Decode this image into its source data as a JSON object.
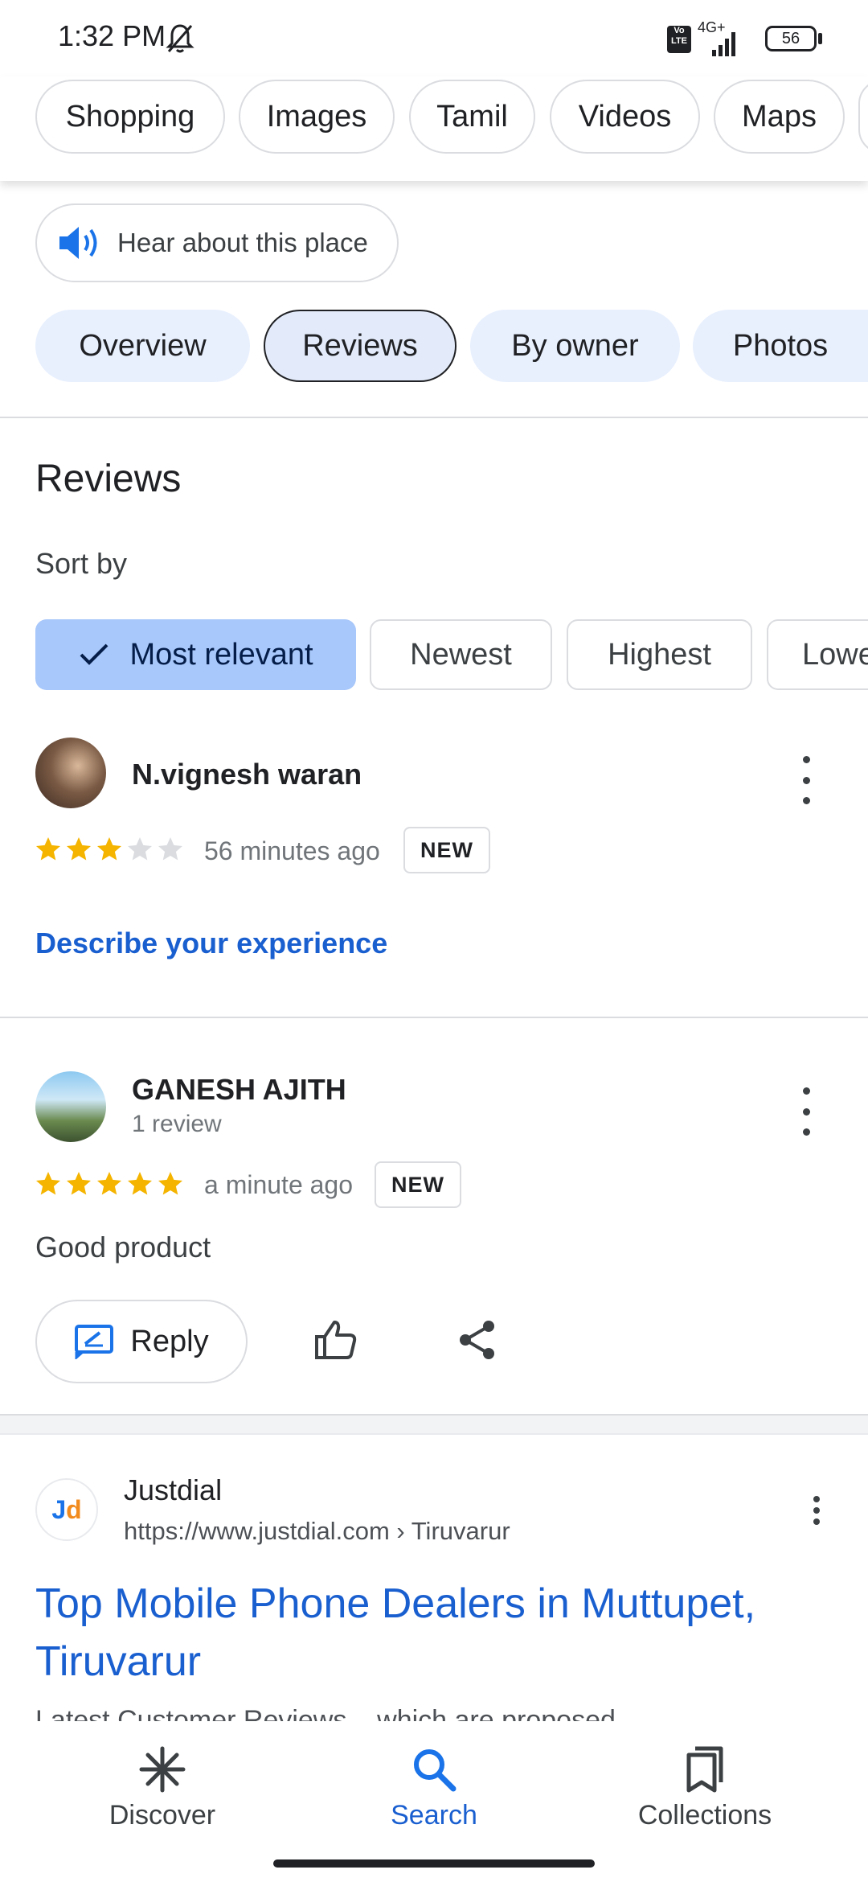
{
  "status": {
    "time": "1:32 PM",
    "network": "4G+",
    "battery": "56",
    "volte": "Vo LTE"
  },
  "chips": [
    "Shopping",
    "Images",
    "Tamil",
    "Videos",
    "Maps"
  ],
  "hear_label": "Hear about this place",
  "place_tabs": [
    {
      "label": "Overview",
      "active": false
    },
    {
      "label": "Reviews",
      "active": true
    },
    {
      "label": "By owner",
      "active": false
    },
    {
      "label": "Photos",
      "active": false
    }
  ],
  "reviews": {
    "title": "Reviews",
    "sort_by": "Sort by",
    "sort_options": [
      {
        "label": "Most relevant",
        "selected": true
      },
      {
        "label": "Newest",
        "selected": false
      },
      {
        "label": "Highest",
        "selected": false
      },
      {
        "label": "Lowe",
        "selected": false
      }
    ],
    "items": [
      {
        "name": "N.vignesh waran",
        "rating": 3,
        "time": "56 minutes ago",
        "badge": "NEW",
        "action_link": "Describe your experience"
      },
      {
        "name": "GANESH AJITH",
        "subtitle": "1 review",
        "rating": 5,
        "time": "a minute ago",
        "badge": "NEW",
        "text": "Good product",
        "reply_label": "Reply"
      }
    ]
  },
  "result": {
    "logo_text": "Jd",
    "site": "Justdial",
    "url": "https://www.justdial.com › Tiruvarur",
    "title": "Top Mobile Phone Dealers in Muttupet, Tiruvarur",
    "snippet": "Latest Customer Reviews... which are proposed"
  },
  "bottom_nav": [
    {
      "label": "Discover",
      "icon": "asterisk-icon",
      "active": false
    },
    {
      "label": "Search",
      "icon": "search-icon",
      "active": true
    },
    {
      "label": "Collections",
      "icon": "collections-icon",
      "active": false
    }
  ],
  "colors": {
    "accent": "#1a5fd0",
    "star": "#f4b400",
    "chip_selected": "#a8c7fa",
    "tab_bg": "#e8f0fe"
  }
}
